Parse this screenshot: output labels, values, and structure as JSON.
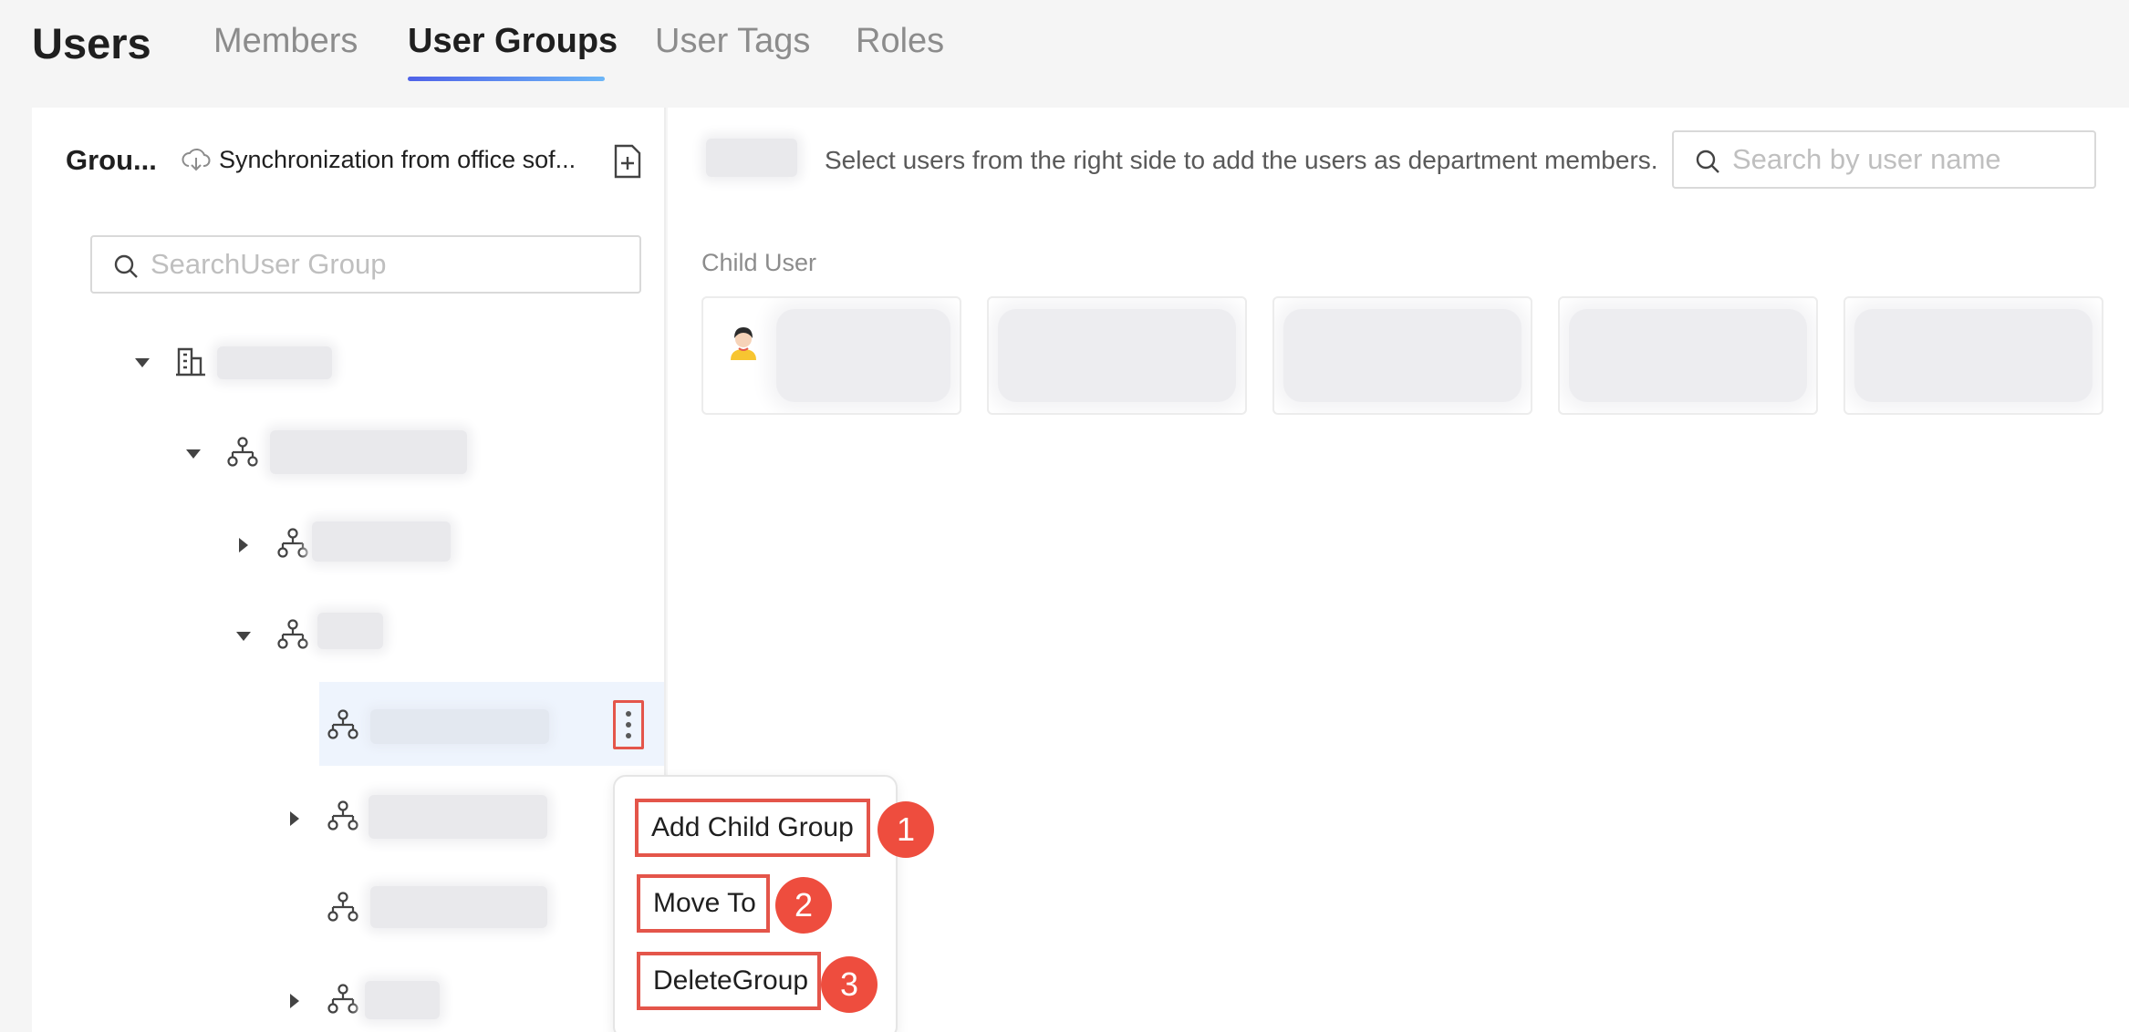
{
  "header": {
    "title": "Users",
    "tabs": [
      {
        "label": "Members",
        "active": false
      },
      {
        "label": "User Groups",
        "active": true
      },
      {
        "label": "User Tags",
        "active": false
      },
      {
        "label": "Roles",
        "active": false
      }
    ],
    "accent_gradient": [
      "#4f62e8",
      "#6cb6f7"
    ]
  },
  "left_panel": {
    "title": "Grou...",
    "sync_label": "Synchronization from office sof...",
    "search_placeholder": "SearchUser Group",
    "tree": [
      {
        "level": 0,
        "caret": "expanded",
        "icon": "building-icon"
      },
      {
        "level": 1,
        "caret": "expanded",
        "icon": "org-structure-icon"
      },
      {
        "level": 2,
        "caret": "collapsed",
        "icon": "org-structure-icon"
      },
      {
        "level": 2,
        "caret": "expanded",
        "icon": "org-structure-icon"
      },
      {
        "level": 3,
        "caret": "none",
        "icon": "org-structure-icon",
        "selected": true
      },
      {
        "level": 3,
        "caret": "collapsed",
        "icon": "org-structure-icon"
      },
      {
        "level": 3,
        "caret": "none",
        "icon": "org-structure-icon"
      },
      {
        "level": 3,
        "caret": "collapsed",
        "icon": "org-structure-icon"
      }
    ]
  },
  "context_menu": {
    "items": [
      {
        "label": "Add Child Group",
        "badge": "1"
      },
      {
        "label": "Move To",
        "badge": "2"
      },
      {
        "label": "DeleteGroup",
        "badge": "3"
      }
    ],
    "highlight_color": "#e4554a",
    "badge_color": "#ee4d3e"
  },
  "right_panel": {
    "hint": "Select users from the right side to add the users as department members.",
    "search_placeholder": "Search by user name",
    "section_label": "Child User"
  }
}
